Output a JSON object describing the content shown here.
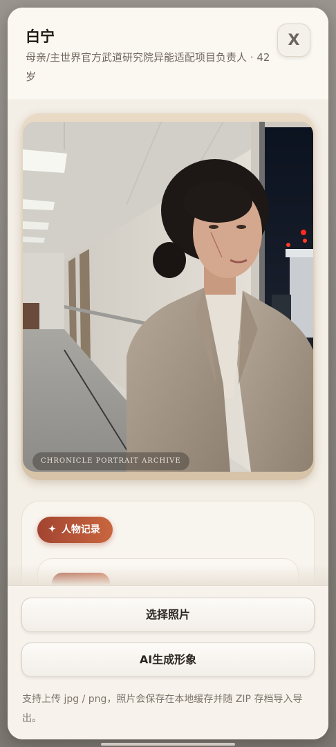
{
  "header": {
    "name": "白宁",
    "role": "母亲/主世界官方武道研究院异能适配项目负责人 · 42岁",
    "close_label": "X"
  },
  "portrait": {
    "watermark": "CHRONICLE PORTRAIT ARCHIVE"
  },
  "record": {
    "chip_icon": "sparkle-icon",
    "chip_label": "人物记录"
  },
  "footer": {
    "choose_photo_label": "选择照片",
    "ai_generate_label": "AI生成形象",
    "hint": "支持上传 jpg / png，照片会保存在本地缓存并随 ZIP 存档导入导出。"
  },
  "colors": {
    "accent": "#b0503a",
    "sheet_bg": "#f7f3ec",
    "text_primary": "#1e1a16",
    "text_secondary": "#6f665c"
  }
}
